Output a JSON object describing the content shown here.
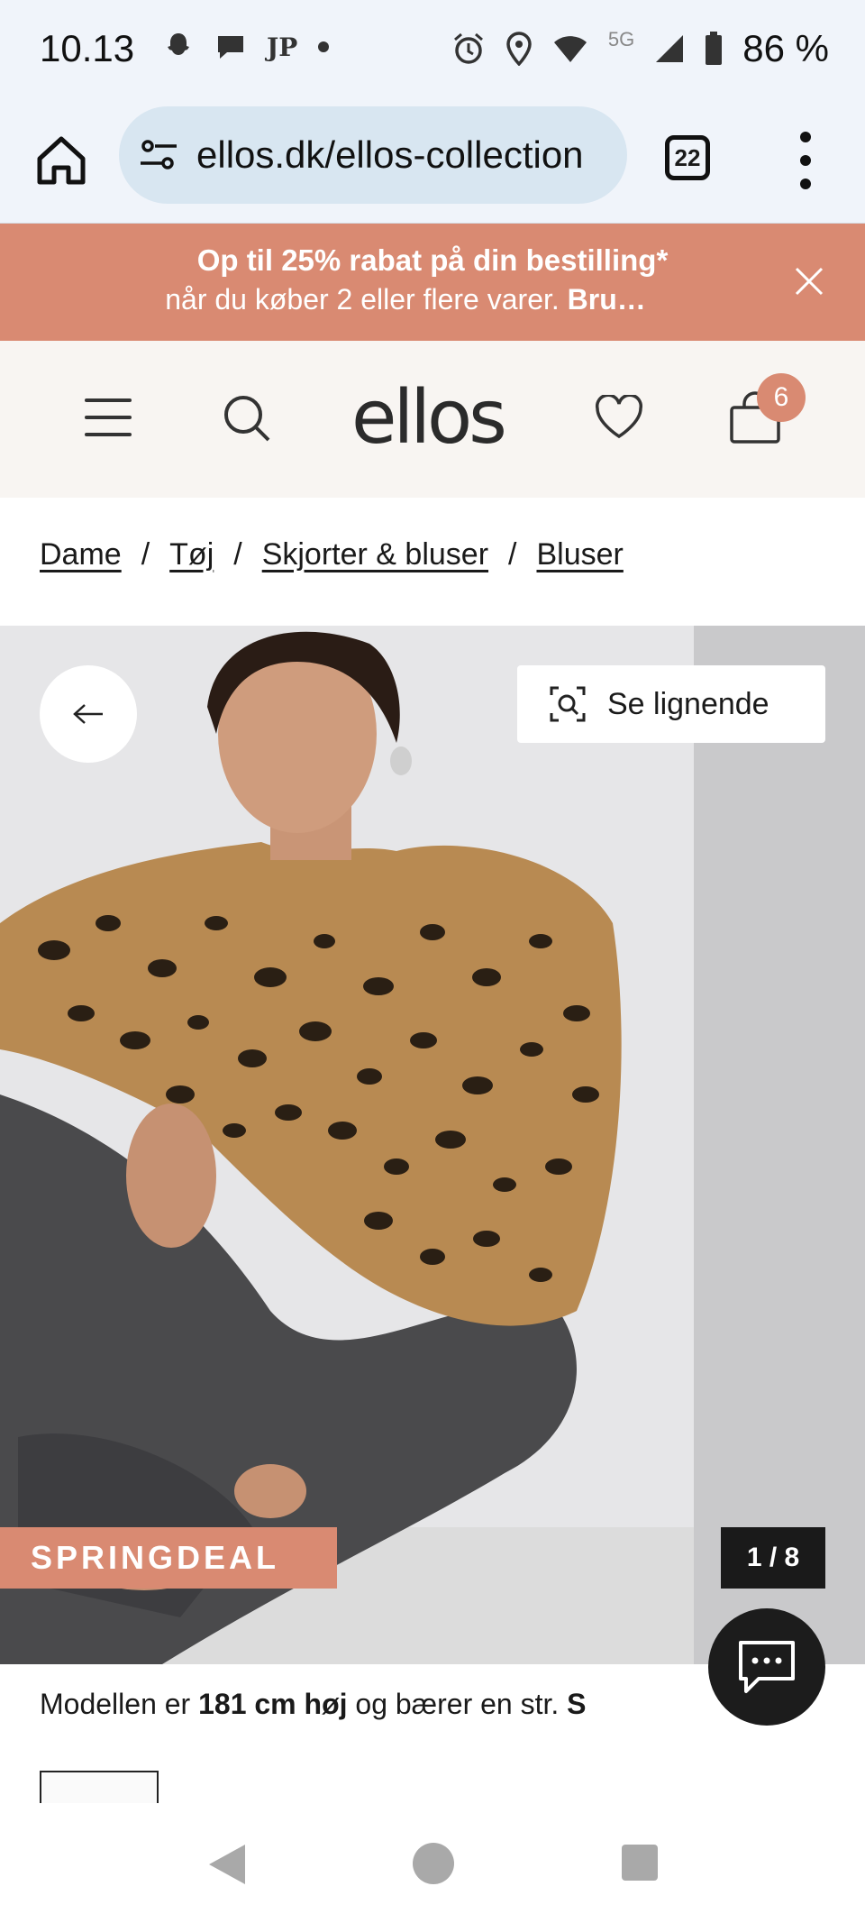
{
  "status_bar": {
    "time": "10.13",
    "notification_icons": [
      "snapchat-icon",
      "chat-bubble-icon",
      "jp-icon",
      "dot-icon"
    ],
    "jp_label": "JP",
    "network_label": "5G",
    "battery": "86 %",
    "status_icons": [
      "alarm-icon",
      "location-icon",
      "wifi-icon",
      "signal-icon",
      "battery-icon"
    ]
  },
  "browser": {
    "url": "ellos.dk/ellos-collection",
    "tab_count": "22"
  },
  "promo": {
    "line1": "Op til 25% rabat på din bestilling*",
    "line2_prefix": "når du køber 2 eller flere varer. ",
    "line2_bold": "Bru…"
  },
  "header": {
    "logo": "ellos",
    "cart_count": "6",
    "accent_color": "#d98a72"
  },
  "breadcrumb": {
    "items": [
      "Dame",
      "Tøj",
      "Skjorter & bluser",
      "Bluser"
    ],
    "separator": "/"
  },
  "gallery": {
    "similar_label": "Se lignende",
    "tag": "SPRINGDEAL",
    "counter": "1 / 8"
  },
  "model_info": {
    "prefix": "Modellen er ",
    "height": "181 cm høj",
    "middle": " og bærer en str. ",
    "size": "S"
  }
}
